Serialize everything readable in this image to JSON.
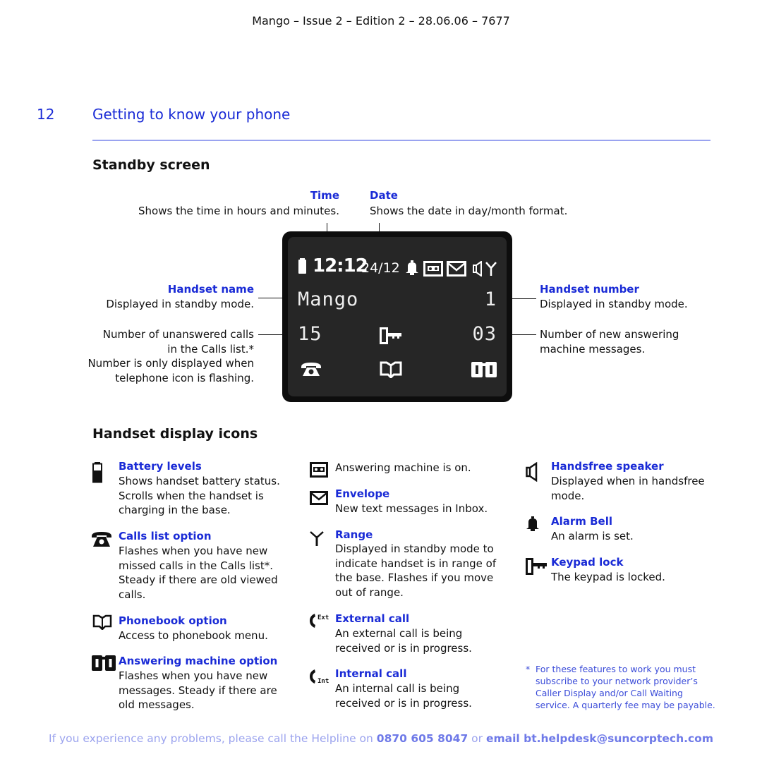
{
  "header": {
    "doc_ref": "Mango – Issue 2 – Edition 2 – 28.06.06 – 7677"
  },
  "chapter": {
    "number": "12",
    "title": "Getting to know your phone"
  },
  "standby": {
    "heading": "Standby screen",
    "callouts": {
      "time": {
        "label": "Time",
        "text": "Shows the time in hours and minutes."
      },
      "date": {
        "label": "Date",
        "text": "Shows the date in day/month format."
      },
      "handset_name": {
        "label": "Handset name",
        "text": "Displayed in standby mode."
      },
      "unanswered": {
        "lines": [
          "Number of unanswered calls",
          "in the Calls list.*",
          "Number is only displayed when",
          "telephone icon is flashing."
        ]
      },
      "handset_number": {
        "label": "Handset number",
        "text": "Displayed in standby mode."
      },
      "new_messages": {
        "lines": [
          "Number of new answering",
          "machine messages."
        ]
      }
    },
    "screen": {
      "time": "12:12",
      "date": "24/12",
      "handset_name": "Mango",
      "handset_number": "1",
      "missed_calls": "15",
      "new_messages": "03",
      "status_icons": [
        "battery-icon",
        "alarm-bell-icon",
        "answering-machine-on-icon",
        "envelope-icon",
        "speaker-icon",
        "range-antenna-icon"
      ],
      "bottom_icons": [
        "calls-list-icon",
        "phonebook-icon",
        "answering-machine-option-icon"
      ],
      "middle_icon": "keypad-lock-icon"
    }
  },
  "icons_section": {
    "heading": "Handset display icons",
    "col1": [
      {
        "icon": "battery-icon",
        "label": "Battery levels",
        "lines": [
          "Shows handset battery status.",
          "Scrolls when the handset is",
          "charging in the base."
        ]
      },
      {
        "icon": "calls-list-icon",
        "label": "Calls list option",
        "lines": [
          "Flashes when you have new",
          "missed calls in the Calls list*.",
          "Steady if there are old viewed",
          "calls."
        ]
      },
      {
        "icon": "phonebook-icon",
        "label": "Phonebook option",
        "lines": [
          "Access to phonebook menu."
        ]
      },
      {
        "icon": "answering-machine-option-icon",
        "label": "Answering machine option",
        "lines": [
          "Flashes when you have new",
          "messages. Steady if there are",
          "old messages."
        ]
      }
    ],
    "col2": [
      {
        "icon": "answering-machine-on-icon",
        "label": "",
        "lines": [
          "Answering machine is on."
        ]
      },
      {
        "icon": "envelope-icon",
        "label": "Envelope",
        "lines": [
          "New text messages in Inbox."
        ]
      },
      {
        "icon": "range-antenna-icon",
        "label": "Range",
        "lines": [
          "Displayed in standby mode to",
          "indicate handset is in range of",
          "the base. Flashes if you move",
          "out of range."
        ]
      },
      {
        "icon": "external-call-icon",
        "icon_text": "Ext",
        "label": "External call",
        "lines": [
          "An external call is being",
          "received or is in progress."
        ]
      },
      {
        "icon": "internal-call-icon",
        "icon_text": "Int",
        "label": "Internal call",
        "lines": [
          "An internal call is being",
          "received or is in progress."
        ]
      }
    ],
    "col3": [
      {
        "icon": "speaker-icon",
        "label": "Handsfree speaker",
        "lines": [
          "Displayed when in handsfree",
          "mode."
        ]
      },
      {
        "icon": "alarm-bell-icon",
        "label": "Alarm Bell",
        "lines": [
          "An alarm is set."
        ]
      },
      {
        "icon": "keypad-lock-icon",
        "label": "Keypad lock",
        "lines": [
          "The keypad is locked."
        ]
      }
    ]
  },
  "footnote": {
    "marker": "*",
    "lines": [
      "For these features to work you must",
      "subscribe to your network provider’s",
      "Caller Display and/or Call Waiting",
      "service. A quarterly fee may be payable."
    ]
  },
  "footer": {
    "prefix": "If you experience any problems, please call the Helpline on ",
    "phone": "0870 605 8047",
    "middle": " or ",
    "email": "email bt.helpdesk@suncorptech.com"
  },
  "colors": {
    "accent": "#1a2bd6",
    "rule": "#9aa3f0",
    "footer": "#9ba3ee",
    "screen": "#262626"
  }
}
